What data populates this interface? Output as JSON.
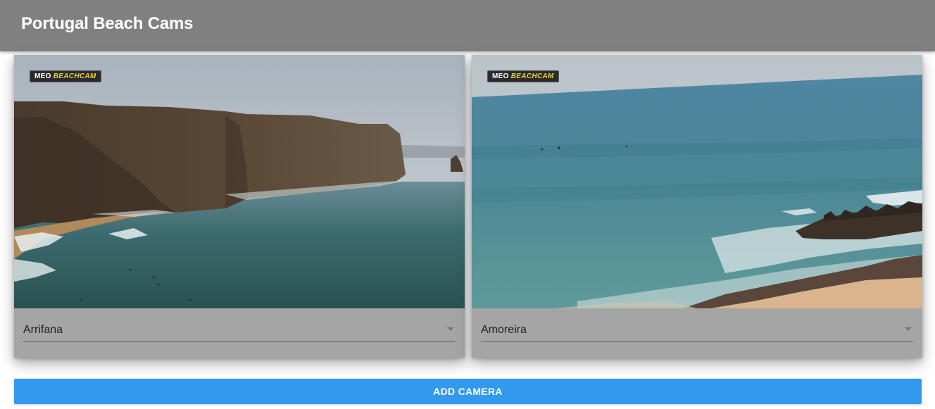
{
  "appbar": {
    "title": "Portugal Beach Cams"
  },
  "cameras": [
    {
      "badge_prefix": "MEO",
      "badge_brand": "BEACHCAM",
      "selected": "Arrifana"
    },
    {
      "badge_prefix": "MEO",
      "badge_brand": "BEACHCAM",
      "selected": "Amoreira"
    }
  ],
  "actions": {
    "add_camera_label": "ADD CAMERA"
  },
  "colors": {
    "appbar": "#808080",
    "card": "#a5a5a5",
    "button": "#3399ee",
    "badge_brand": "#e6d23a"
  },
  "icons": {
    "select_arrow": "caret-down-icon"
  }
}
